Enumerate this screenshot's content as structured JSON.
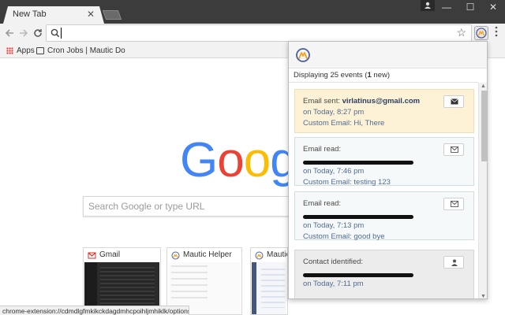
{
  "browser": {
    "tab_title": "New Tab",
    "tab_close": "✕",
    "window_buttons": [
      "—",
      "☐",
      "✕"
    ],
    "address_value": "",
    "bookmarks": {
      "apps_label": "Apps",
      "cron_label": "Cron Jobs | Mautic Do"
    },
    "status_text": "chrome-extension://cdmdlgfmkikckdagdmhcpoihljmhiklk/options.html"
  },
  "newtab": {
    "logo_letters": [
      "G",
      "o",
      "o",
      "g"
    ],
    "logo_colors": [
      "#4285f4",
      "#ea4335",
      "#fbbc05",
      "#4285f4"
    ],
    "search_placeholder": "Search Google or type URL",
    "tiles": [
      {
        "title": "Gmail",
        "icon": "gmail-icon"
      },
      {
        "title": "Mautic Helper",
        "icon": "mautic-icon"
      },
      {
        "title": "Mautic",
        "icon": "mautic-icon"
      }
    ]
  },
  "popup": {
    "summary_prefix": "Displaying 25 events (",
    "summary_count": "1",
    "summary_suffix": " new)",
    "events": [
      {
        "type": "Email sent: ",
        "email": "virlatinus@gmail.com",
        "time": "on Today, 8:27 pm",
        "detail": "Custom Email: Hi, There",
        "icon": "envelope-icon",
        "style": "highlight"
      },
      {
        "type": "Email read:",
        "time": "on Today, 7:46 pm",
        "detail": "Custom Email: testing 123",
        "icon": "envelope-outline-icon",
        "style": "normal"
      },
      {
        "type": "Email read:",
        "time": "on Today, 7:13 pm",
        "detail": "Custom Email: good bye",
        "icon": "envelope-outline-icon",
        "style": "normal"
      },
      {
        "type": "Contact identified:",
        "time": "on Today, 7:11 pm",
        "icon": "user-icon",
        "style": "grey"
      }
    ]
  }
}
